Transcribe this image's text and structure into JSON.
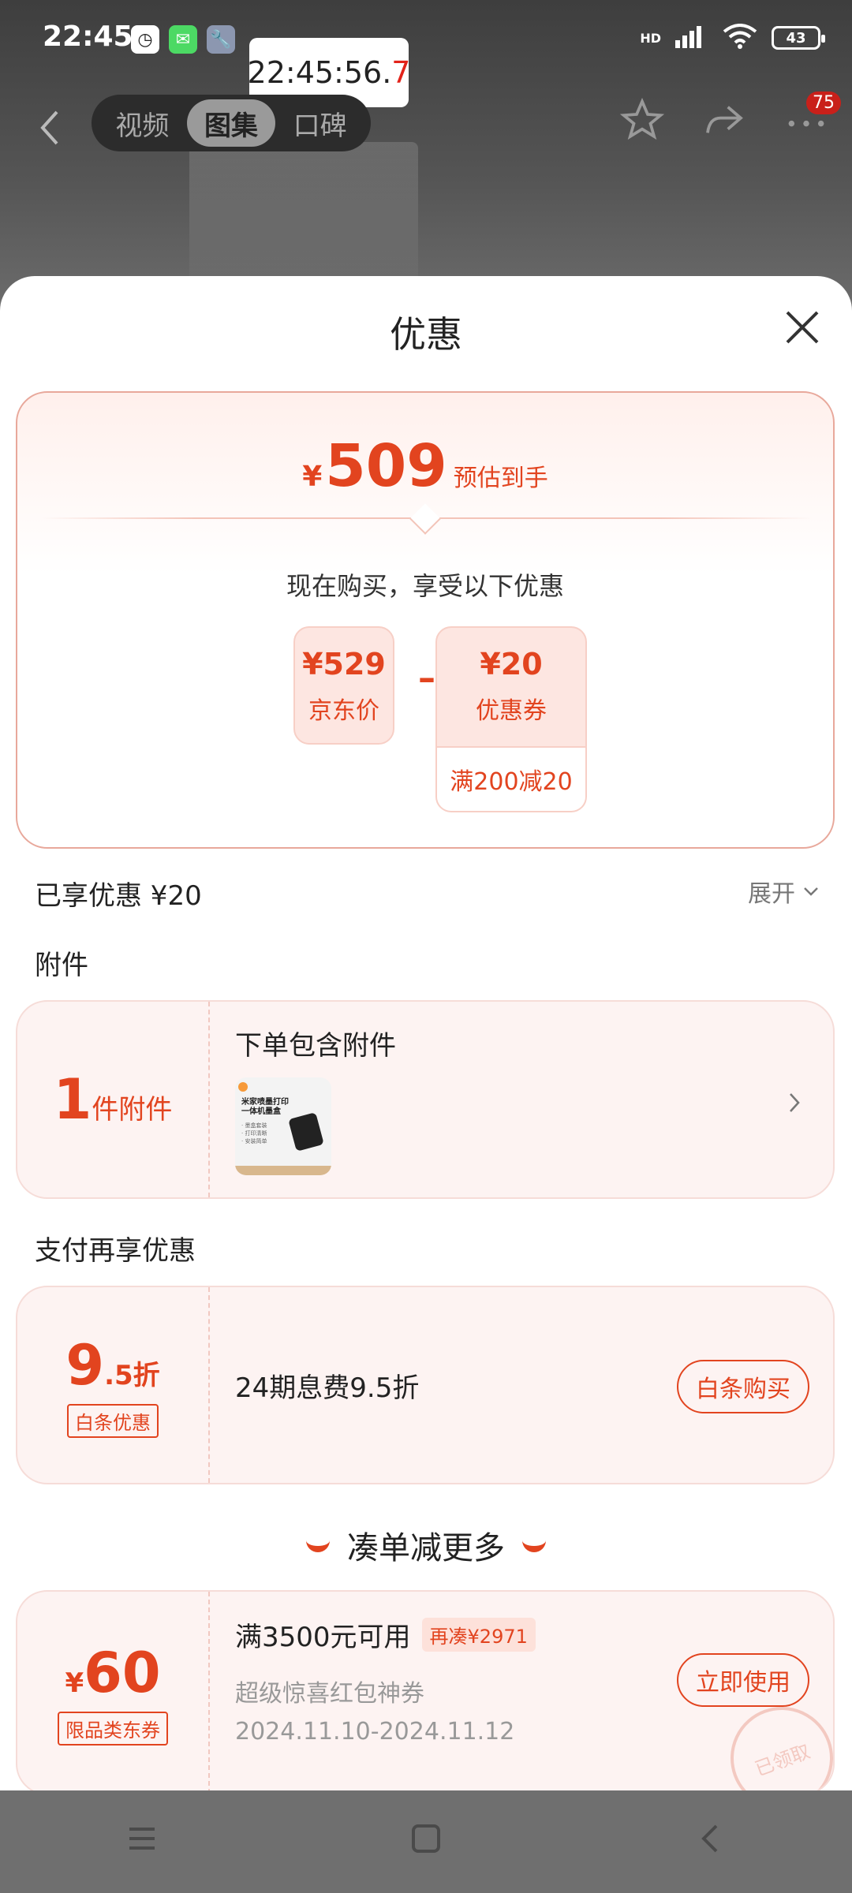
{
  "status": {
    "time": "22:45",
    "battery": "43",
    "network": "HD"
  },
  "clock_popup": {
    "main": "22:45:56.",
    "tenth": "7"
  },
  "top_nav": {
    "tabs": [
      "视频",
      "图集",
      "口碑"
    ],
    "active": 1,
    "badge": "75"
  },
  "sheet": {
    "title": "优惠",
    "estimate": {
      "yen": "¥",
      "amount": "509",
      "label": "预估到手"
    },
    "buy_now_text": "现在购买，享受以下优惠",
    "jd_price": {
      "value": "¥529",
      "label": "京东价"
    },
    "coupon": {
      "value": "¥20",
      "label": "优惠券",
      "condition": "满200减20"
    },
    "minus_sign": "–",
    "saved": "已享优惠 ¥20",
    "expand": "展开"
  },
  "accessory": {
    "section": "附件",
    "count": "1",
    "count_unit": "件附件",
    "title": "下单包含附件",
    "thumb_lines": [
      "米家喷墨打印",
      "一体机墨盒",
      "· 墨盒套装",
      "· 打印清晰",
      "· 安装简单"
    ]
  },
  "payment": {
    "section": "支付再享优惠",
    "discount_big": "9",
    "discount_small": ".5折",
    "tag": "白条优惠",
    "desc": "24期息费9.5折",
    "button": "白条购买"
  },
  "combo": {
    "title": "凑单减更多",
    "yen": "¥",
    "amount": "60",
    "tag": "限品类东券",
    "main": "满3500元可用",
    "extra": "再凑¥2971",
    "name": "超级惊喜红包神券",
    "dates": "2024.11.10-2024.11.12",
    "button": "立即使用",
    "stamp": "已领取"
  },
  "colors": {
    "accent": "#e2441f",
    "card_bg": "#fdf3f2"
  },
  "icons": [
    "back-icon",
    "star-icon",
    "share-icon",
    "more-icon",
    "close-icon",
    "chevron-down-icon",
    "chevron-right-icon",
    "menu-icon",
    "home-icon",
    "back-nav-icon"
  ]
}
